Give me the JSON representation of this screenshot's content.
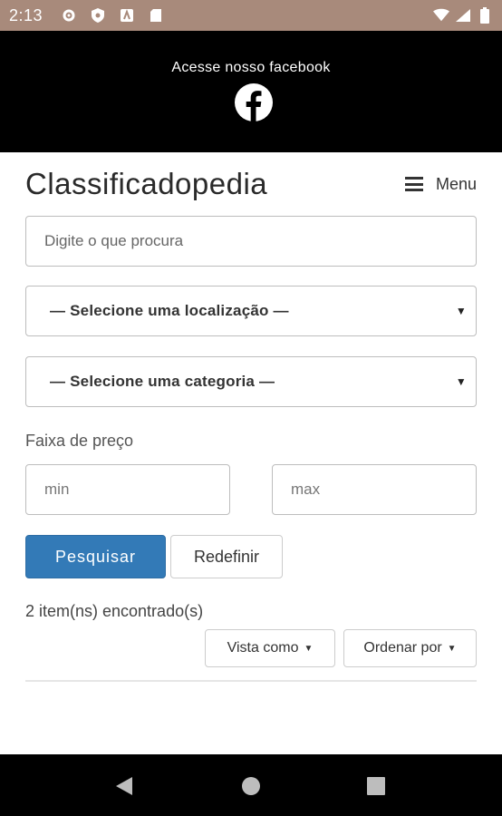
{
  "status_bar": {
    "time": "2:13",
    "left_icons": [
      "gear-icon",
      "shield-icon",
      "a-icon",
      "sd-card-icon"
    ],
    "right_icons": [
      "wifi-icon",
      "signal-icon",
      "battery-icon"
    ]
  },
  "banner": {
    "text": "Acesse nosso facebook",
    "icon": "facebook-icon"
  },
  "header": {
    "title": "Classificadopedia",
    "menu_label": "Menu"
  },
  "search": {
    "placeholder": "Digite o que procura"
  },
  "filters": {
    "location_selected": "— Selecione uma localização —",
    "category_selected": "— Selecione uma categoria —",
    "price_label": "Faixa de preço",
    "min_placeholder": "min",
    "max_placeholder": "max"
  },
  "buttons": {
    "search_label": "Pesquisar",
    "reset_label": "Redefinir",
    "view_as_label": "Vista como",
    "order_by_label": "Ordenar por"
  },
  "results": {
    "count_text": "2 item(ns) encontrado(s)"
  },
  "colors": {
    "status_bar": "#a88a7b",
    "primary_button": "#337ab7"
  }
}
